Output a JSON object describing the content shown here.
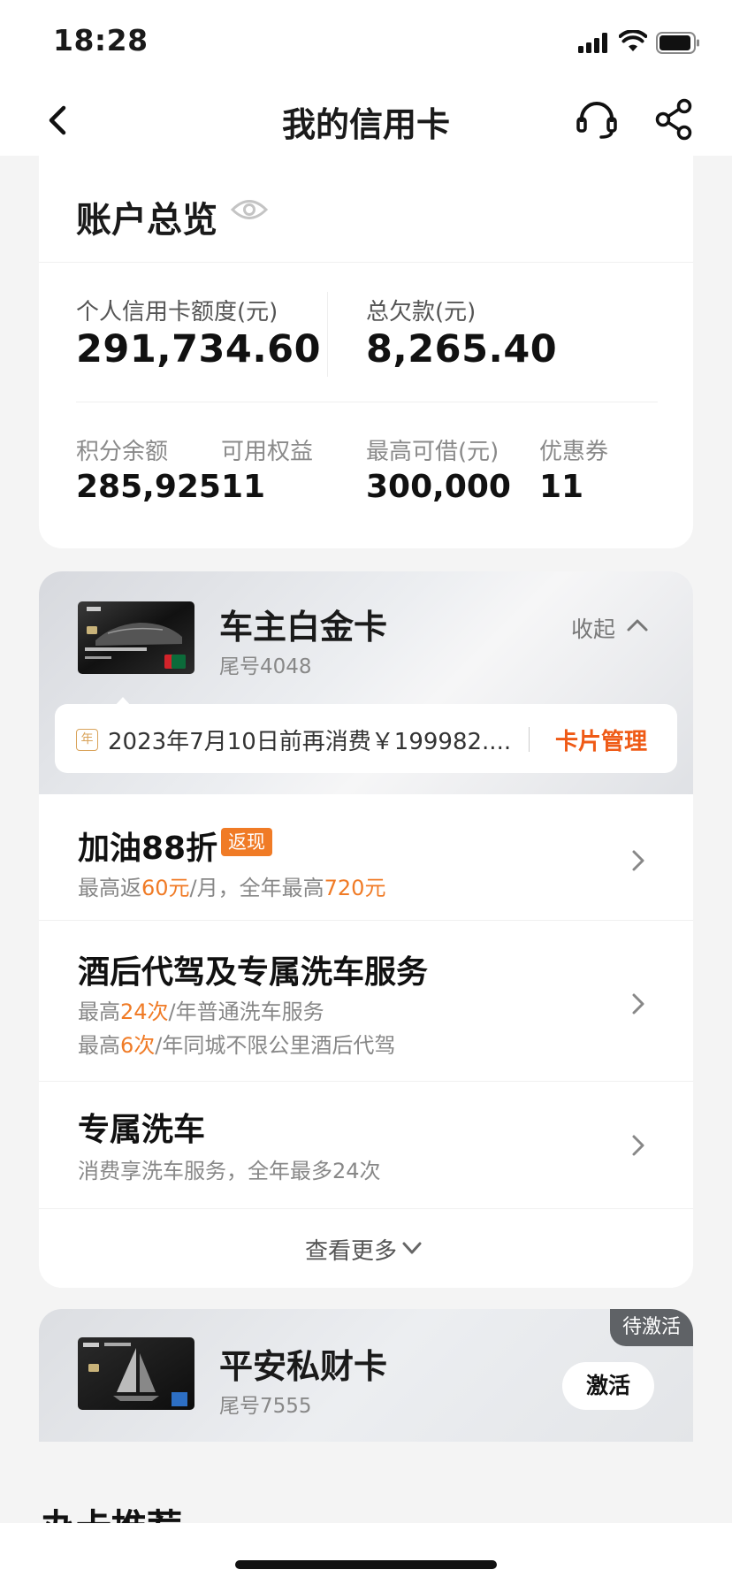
{
  "status_bar": {
    "time": "18:28"
  },
  "nav": {
    "title": "我的信用卡"
  },
  "overview": {
    "title": "账户总览",
    "credit_limit_label": "个人信用卡额度(元)",
    "credit_limit_value": "291,734.60",
    "total_debt_label": "总欠款(元)",
    "total_debt_value": "8,265.40",
    "points_label": "积分余额",
    "points_value": "285,925",
    "rights_label": "可用权益",
    "rights_value": "11",
    "max_borrow_label": "最高可借(元)",
    "max_borrow_value": "300,000",
    "coupons_label": "优惠券",
    "coupons_value": "11"
  },
  "car_card": {
    "name": "车主白金卡",
    "tail": "尾号4048",
    "collapse_label": "收起",
    "notice_icon": "年",
    "notice_text": "2023年7月10日前再消费￥199982....",
    "manage_label": "卡片管理",
    "benefits": [
      {
        "title": "加油88折",
        "tag": "返现",
        "line1": {
          "pre": "最高返",
          "hl1": "60元",
          "mid": "/月，全年最高",
          "hl2": "720元"
        }
      },
      {
        "title": "酒后代驾及专属洗车服务",
        "line1": {
          "pre": "最高",
          "hl": "24次",
          "post": "/年普通洗车服务"
        },
        "line2": {
          "pre": "最高",
          "hl": "6次",
          "post": "/年同城不限公里酒后代驾"
        }
      },
      {
        "title": "专属洗车",
        "sub": "消费享洗车服务，全年最多24次"
      }
    ],
    "see_more": "查看更多"
  },
  "wealth_card": {
    "name": "平安私财卡",
    "tail": "尾号7555",
    "badge": "待激活",
    "activate_label": "激活"
  },
  "recommend_heading": "办卡推荐",
  "colors": {
    "accent_orange": "#ef5a16",
    "highlight_orange": "#f07b26",
    "badge_gray": "#5f6266"
  }
}
